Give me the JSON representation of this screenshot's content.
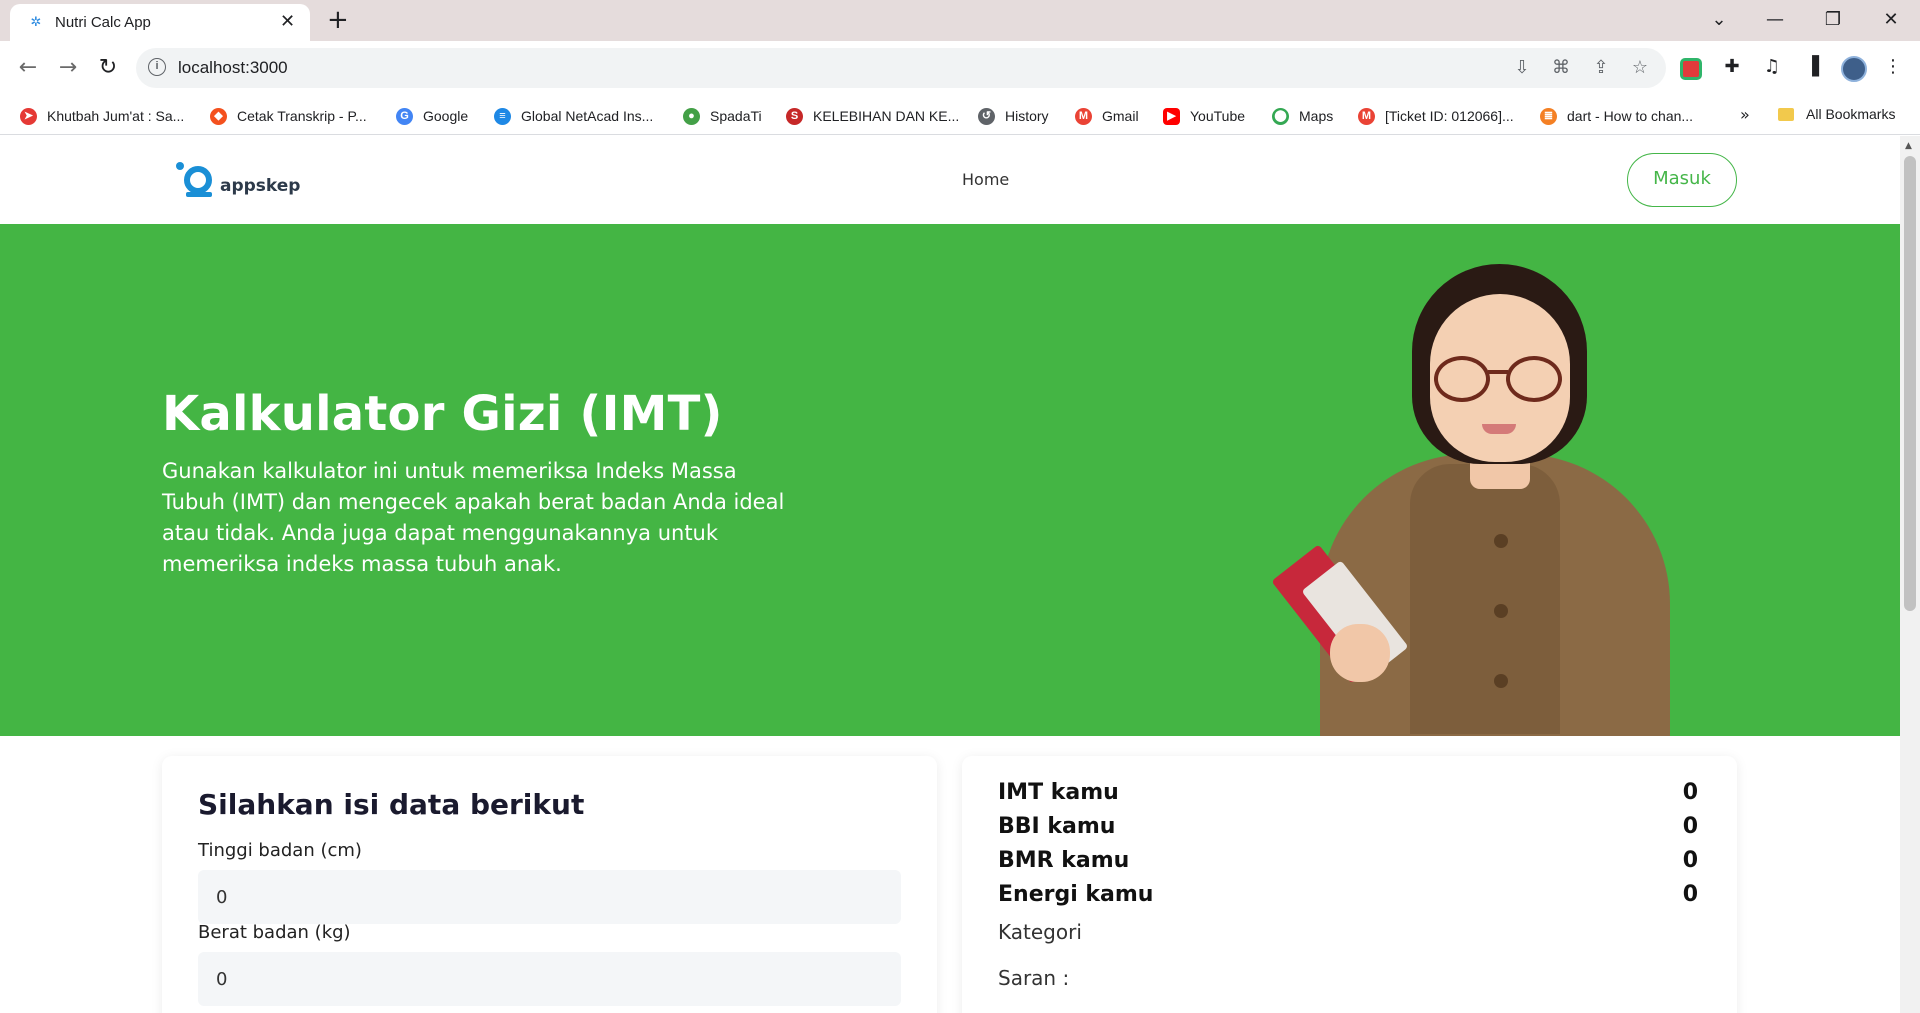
{
  "browser": {
    "tab_title": "Nutri Calc App",
    "url": "localhost:3000",
    "bookmarks": [
      {
        "label": "Khutbah Jum'at : Sa...",
        "color": "#e53935",
        "glyph": "➤"
      },
      {
        "label": "Cetak Transkrip - P...",
        "color": "#f4511e",
        "glyph": "◆"
      },
      {
        "label": "Google",
        "color": "#4285f4",
        "glyph": "G"
      },
      {
        "label": "Global NetAcad Ins...",
        "color": "#1e88e5",
        "glyph": "≡"
      },
      {
        "label": "SpadaTi",
        "color": "#43a047",
        "glyph": "●"
      },
      {
        "label": "KELEBIHAN DAN KE...",
        "color": "#c62828",
        "glyph": "S"
      },
      {
        "label": "History",
        "color": "#5f6368",
        "glyph": "↺"
      },
      {
        "label": "Gmail",
        "color": "#ea4335",
        "glyph": "M"
      },
      {
        "label": "YouTube",
        "color": "#ff0000",
        "glyph": "▶"
      },
      {
        "label": "Maps",
        "color": "#34a853",
        "glyph": "⬤"
      },
      {
        "label": "[Ticket ID: 012066]...",
        "color": "#ea4335",
        "glyph": "M"
      },
      {
        "label": "dart - How to chan...",
        "color": "#f48024",
        "glyph": "≣"
      }
    ],
    "more_bookmarks": "»",
    "all_bookmarks": "All Bookmarks"
  },
  "site": {
    "logo_text": "appskep",
    "nav_home": "Home",
    "login_button": "Masuk"
  },
  "hero": {
    "title": "Kalkulator Gizi (IMT)",
    "description": "Gunakan kalkulator ini untuk memeriksa Indeks Massa Tubuh (IMT) dan mengecek apakah berat badan Anda ideal atau tidak. Anda juga dapat menggunakannya untuk memeriksa indeks massa tubuh anak."
  },
  "form": {
    "title": "Silahkan isi data berikut",
    "height_label": "Tinggi badan (cm)",
    "height_value": "0",
    "weight_label": "Berat badan (kg)",
    "weight_value": "0"
  },
  "results": {
    "imt_label": "IMT kamu",
    "imt_value": "0",
    "bbi_label": "BBI kamu",
    "bbi_value": "0",
    "bmr_label": "BMR kamu",
    "bmr_value": "0",
    "energi_label": "Energi kamu",
    "energi_value": "0",
    "kategori_label": "Kategori",
    "saran_label": "Saran :"
  },
  "colors": {
    "brand_green": "#44b544",
    "logo_blue": "#1a8fd6"
  }
}
